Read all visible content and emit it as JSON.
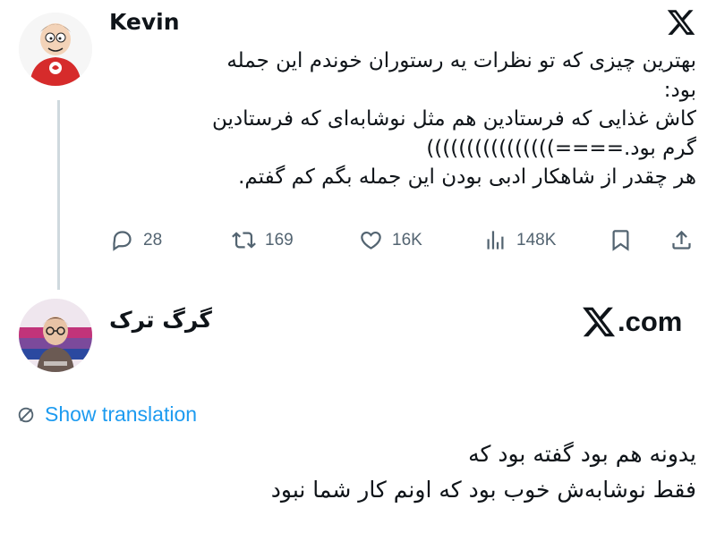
{
  "tweet": {
    "username": "Kevin",
    "lines": [
      "بهترین چیزی که تو نظرات یه رستوران خوندم این جمله",
      "بود:",
      "کاش غذایی که فرستادین هم مثل نوشابه‌ای که فرستادین",
      "گرم بود.====))))))))))))))))",
      "هر چقدر از شاهکار ادبی بودن این جمله بگم کم گفتم."
    ],
    "stats": {
      "replies": "28",
      "retweets": "169",
      "likes": "16K",
      "views": "148K"
    }
  },
  "reply": {
    "username": "گرگ ترک",
    "brand": ".com",
    "translate_label": "Show translation",
    "lines": [
      "یدونه هم بود گفته بود که",
      "فقط نوشابه‌ش خوب بود که اونم کار شما نبود"
    ]
  },
  "colors": {
    "text": "#0f1419",
    "muted": "#536471",
    "link": "#1d9bf0",
    "thread_line": "#cfd9de"
  },
  "icons": [
    "x-logo-icon",
    "reply-icon",
    "retweet-icon",
    "like-icon",
    "views-icon",
    "bookmark-icon",
    "share-icon",
    "translate-icon"
  ]
}
